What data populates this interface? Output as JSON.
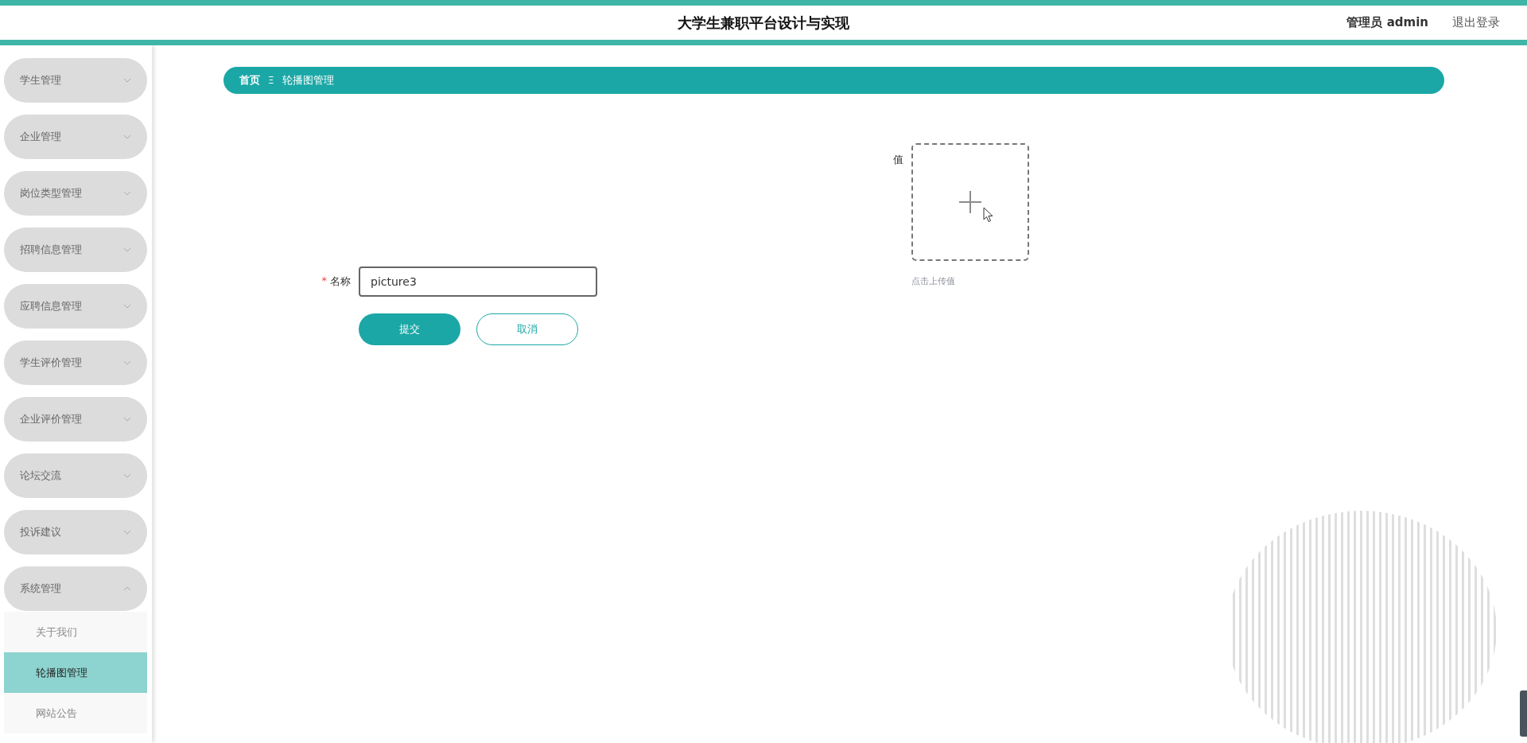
{
  "header": {
    "title": "大学生兼职平台设计与实现",
    "user": "管理员 admin",
    "logout": "退出登录"
  },
  "sidebar": {
    "items": [
      {
        "label": "学生管理",
        "expanded": false
      },
      {
        "label": "企业管理",
        "expanded": false
      },
      {
        "label": "岗位类型管理",
        "expanded": false
      },
      {
        "label": "招聘信息管理",
        "expanded": false
      },
      {
        "label": "应聘信息管理",
        "expanded": false
      },
      {
        "label": "学生评价管理",
        "expanded": false
      },
      {
        "label": "企业评价管理",
        "expanded": false
      },
      {
        "label": "论坛交流",
        "expanded": false
      },
      {
        "label": "投诉建议",
        "expanded": false
      },
      {
        "label": "系统管理",
        "expanded": true,
        "children": [
          {
            "label": "关于我们",
            "selected": false
          },
          {
            "label": "轮播图管理",
            "selected": true
          },
          {
            "label": "网站公告",
            "selected": false
          }
        ]
      }
    ]
  },
  "breadcrumb": {
    "separator": "Ξ",
    "items": [
      {
        "label": "首页"
      },
      {
        "label": "轮播图管理"
      }
    ]
  },
  "form": {
    "upload": {
      "label": "值",
      "hint": "点击上传值"
    },
    "name_field": {
      "required_mark": "*",
      "label": "名称",
      "value": "picture3"
    },
    "buttons": [
      {
        "kind": "primary",
        "label": "提交"
      },
      {
        "kind": "secondary",
        "label": "取消"
      }
    ]
  }
}
